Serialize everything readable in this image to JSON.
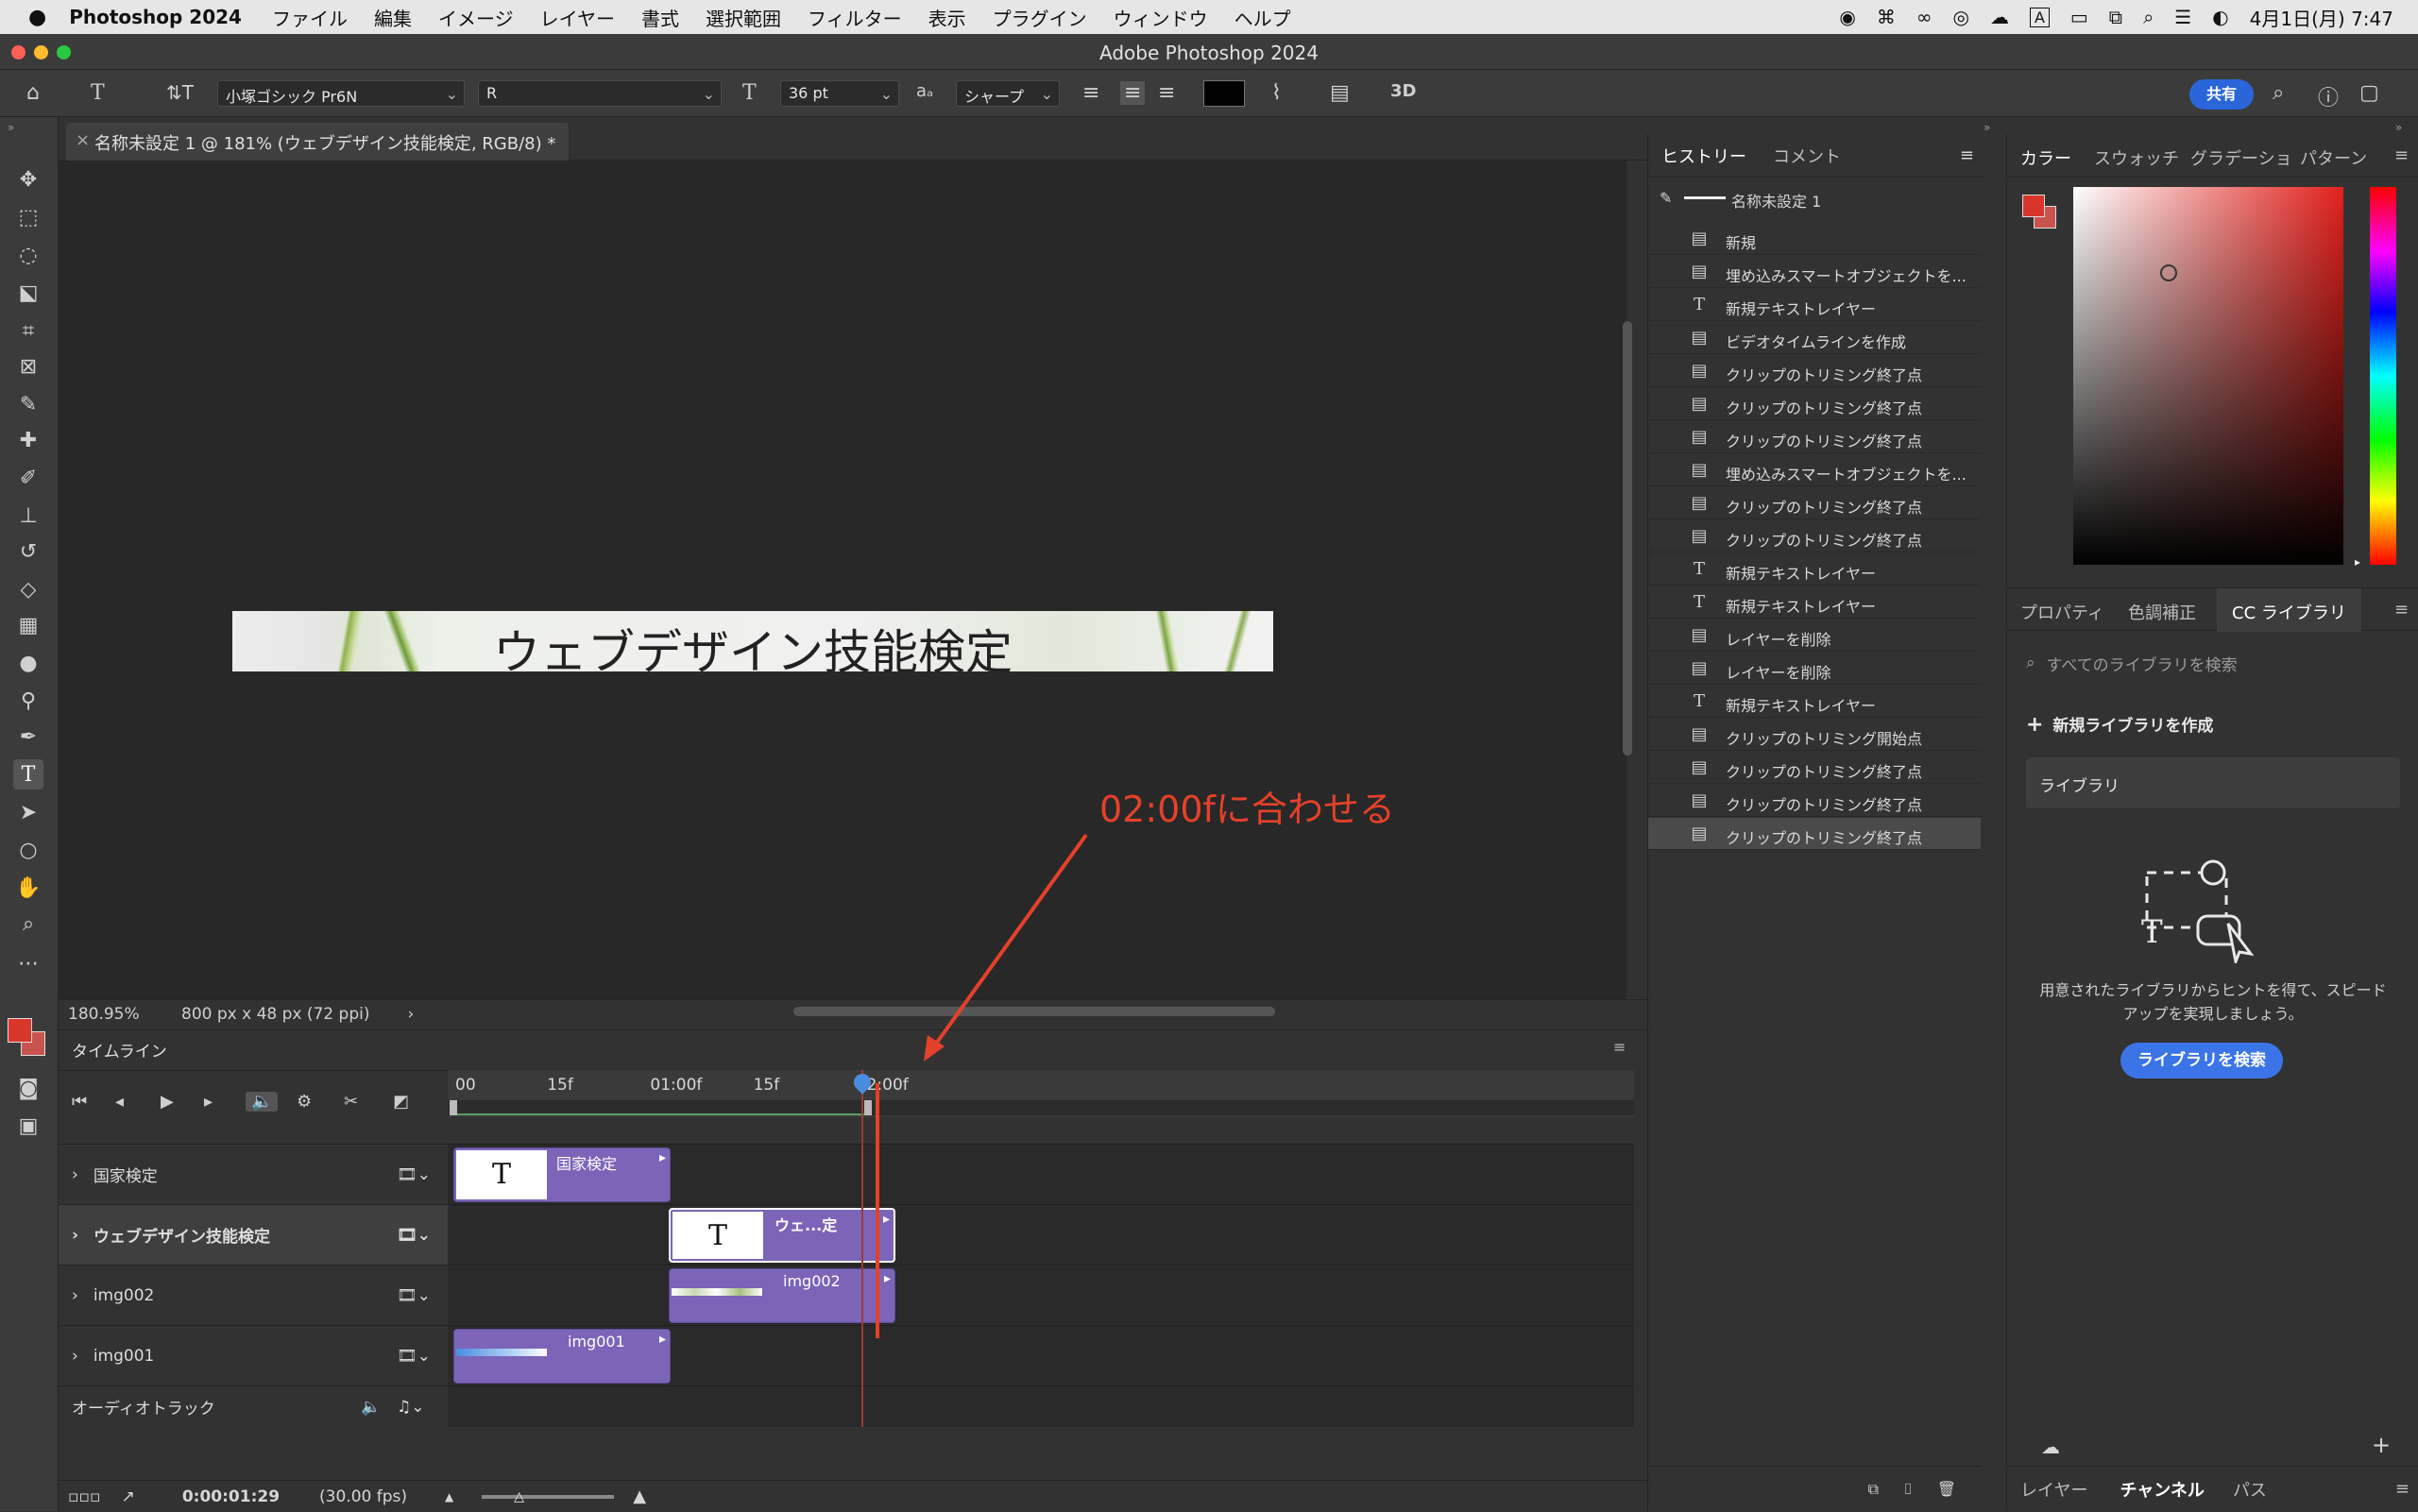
{
  "menubar": {
    "app": "Photoshop 2024",
    "items": [
      "ファイル",
      "編集",
      "イメージ",
      "レイヤー",
      "書式",
      "選択範囲",
      "フィルター",
      "表示",
      "プラグイン",
      "ウィンドウ",
      "ヘルプ"
    ],
    "clock": "4月1日(月) 7:47"
  },
  "window": {
    "title": "Adobe Photoshop 2024"
  },
  "options": {
    "font_family": "小塚ゴシック Pr6N",
    "font_style": "R",
    "font_size": "36 pt",
    "antialias": "シャープ",
    "share": "共有",
    "mode3d": "3D"
  },
  "document": {
    "tab": "名称未設定 1 @ 181% (ウェブデザイン技能検定, RGB/8) *",
    "canvas_text": "ウェブデザイン技能検定",
    "zoom": "180.95%",
    "size": "800 px x 48 px (72 ppi)"
  },
  "timeline": {
    "title": "タイムライン",
    "ticks": [
      "00",
      "15f",
      "01:00f",
      "15f",
      "02:00f"
    ],
    "tracks": [
      {
        "name": "国家検定",
        "clip": "国家検定"
      },
      {
        "name": "ウェブデザイン技能検定",
        "clip": "ウェ...定"
      },
      {
        "name": "img002",
        "clip": "img002"
      },
      {
        "name": "img001",
        "clip": "img001"
      }
    ],
    "audio": "オーディオトラック",
    "timecode": "0:00:01:29",
    "fps": "(30.00 fps)",
    "playhead_frames": 59,
    "target_frames": 60
  },
  "annotation": "02:00fに合わせる",
  "history": {
    "tabs": [
      "ヒストリー",
      "コメント"
    ],
    "snapshot": "名称未設定 1",
    "items": [
      {
        "icon": "doc",
        "label": "新規"
      },
      {
        "icon": "doc",
        "label": "埋め込みスマートオブジェクトを..."
      },
      {
        "icon": "T",
        "label": "新規テキストレイヤー"
      },
      {
        "icon": "doc",
        "label": "ビデオタイムラインを作成"
      },
      {
        "icon": "doc",
        "label": "クリップのトリミング終了点"
      },
      {
        "icon": "doc",
        "label": "クリップのトリミング終了点"
      },
      {
        "icon": "doc",
        "label": "クリップのトリミング終了点"
      },
      {
        "icon": "doc",
        "label": "埋め込みスマートオブジェクトを..."
      },
      {
        "icon": "doc",
        "label": "クリップのトリミング終了点"
      },
      {
        "icon": "doc",
        "label": "クリップのトリミング終了点"
      },
      {
        "icon": "T",
        "label": "新規テキストレイヤー"
      },
      {
        "icon": "T",
        "label": "新規テキストレイヤー"
      },
      {
        "icon": "doc",
        "label": "レイヤーを削除"
      },
      {
        "icon": "doc",
        "label": "レイヤーを削除"
      },
      {
        "icon": "T",
        "label": "新規テキストレイヤー"
      },
      {
        "icon": "doc",
        "label": "クリップのトリミング開始点"
      },
      {
        "icon": "doc",
        "label": "クリップのトリミング終了点"
      },
      {
        "icon": "doc",
        "label": "クリップのトリミング終了点"
      },
      {
        "icon": "doc",
        "label": "クリップのトリミング終了点"
      }
    ]
  },
  "color_panel": {
    "tabs": [
      "カラー",
      "スウォッチ",
      "グラデーショ",
      "パターン"
    ],
    "fg_color": "#d9362b",
    "bg_color": "#c9544f"
  },
  "library_panel": {
    "tabs": [
      "プロパティ",
      "色調補正",
      "CC ライブラリ"
    ],
    "search_placeholder": "すべてのライブラリを検索",
    "new_library": "新規ライブラリを作成",
    "library_name": "ライブラリ",
    "hint": "用意されたライブラリからヒントを得て、スピードアップを実現しましょう。",
    "button": "ライブラリを検索"
  },
  "bottom_tabs": [
    "レイヤー",
    "チャンネル",
    "パス"
  ]
}
